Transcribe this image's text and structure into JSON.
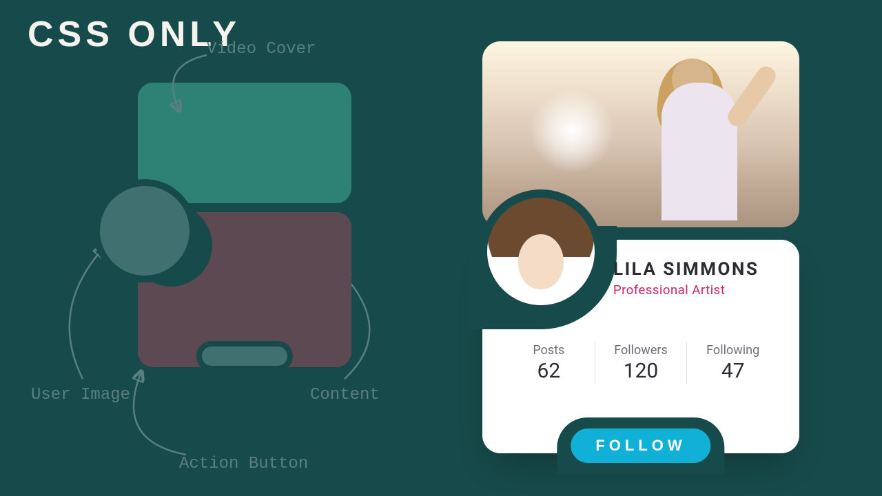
{
  "page": {
    "title": "CSS ONLY"
  },
  "diagram": {
    "labels": {
      "video_cover": "Video Cover",
      "user_image": "User Image",
      "content": "Content",
      "action_button": "Action Button"
    }
  },
  "profile": {
    "name": "LILA SIMMONS",
    "role": "Professional Artist",
    "stats": {
      "posts": {
        "label": "Posts",
        "value": "62"
      },
      "followers": {
        "label": "Followers",
        "value": "120"
      },
      "following": {
        "label": "Following",
        "value": "47"
      }
    },
    "follow_label": "FOLLOW"
  },
  "colors": {
    "bg": "#174a4a",
    "accent": "#11b0d6",
    "role": "#c9246b"
  }
}
